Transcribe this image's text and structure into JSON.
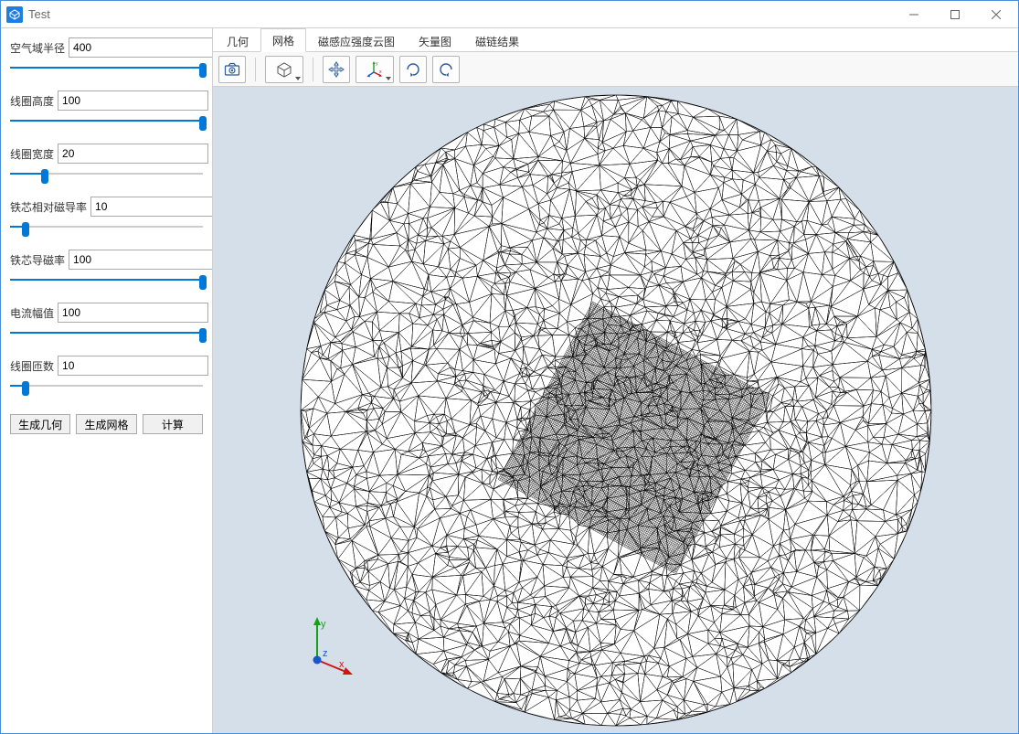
{
  "window": {
    "title": "Test"
  },
  "sidebar": {
    "params": [
      {
        "label": "空气域半径",
        "value": "400",
        "fill": 100
      },
      {
        "label": "线圈高度",
        "value": "100",
        "fill": 100
      },
      {
        "label": "线圈宽度",
        "value": "20",
        "fill": 18
      },
      {
        "label": "铁芯相对磁导率",
        "value": "10",
        "fill": 8
      },
      {
        "label": "铁芯导磁率",
        "value": "100",
        "fill": 100
      },
      {
        "label": "电流幅值",
        "value": "100",
        "fill": 100
      },
      {
        "label": "线圈匝数",
        "value": "10",
        "fill": 8
      }
    ],
    "buttons": {
      "gen_geometry": "生成几何",
      "gen_mesh": "生成网格",
      "compute": "计算"
    }
  },
  "tabs": {
    "items": [
      "几何",
      "网格",
      "磁感应强度云图",
      "矢量图",
      "磁链结果"
    ],
    "active_index": 1
  },
  "toolbar": {
    "icons": [
      "camera-icon",
      "cube-icon",
      "pan-icon",
      "axes-icon",
      "rotate-cw-icon",
      "rotate-ccw-icon"
    ]
  },
  "triad": {
    "x": "x",
    "y": "y",
    "z": "z"
  }
}
